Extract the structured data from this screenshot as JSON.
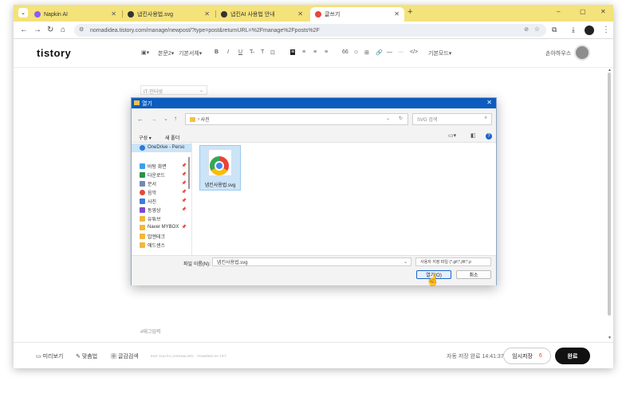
{
  "browser": {
    "tabs": [
      {
        "title": "Napkin AI",
        "color": "#8a5cf6"
      },
      {
        "title": "냅킨사용법.svg",
        "color": "#333333"
      },
      {
        "title": "냅킨AI 사용법 안내",
        "color": "#333333"
      },
      {
        "title": "글쓰기",
        "color": "#e8453c"
      }
    ],
    "new_tab": "+",
    "url": "nomadidea.tistory.com/manage/newpost/?type=post&returnURL=%2Fmanage%2Fposts%2F",
    "window_controls": [
      "–",
      "▢",
      "✕"
    ]
  },
  "editor": {
    "logo": "tistory",
    "toolbar": {
      "paragraph": "본문2",
      "font": "기본서체",
      "style": "기본모드"
    },
    "user": "손아하우스",
    "category_placeholder": "IT·인터넷",
    "tag_placeholder": "#태그입력"
  },
  "footer": {
    "preview": "미리보기",
    "spellcheck": "맞춤법",
    "search": "글감검색",
    "credits1": "EDIT SOUTH | CHROMLORG",
    "credits2": "POWERED BY TIFT",
    "autosave": "자동 저장 완료 14:41:37",
    "temp_save": "임시저장",
    "temp_count": "6",
    "done": "완료"
  },
  "dialog": {
    "title": "열기",
    "path_sep": "›",
    "path": "사진",
    "search_placeholder": "SVG 검색",
    "organize": "구성 ▾",
    "new_folder": "새 폴더",
    "sidebar": [
      {
        "label": "OneDrive - Perso",
        "color": "#2a7bd8",
        "pinned": false
      },
      {
        "label": "바탕 화면",
        "color": "#3aa0e8",
        "pinned": true
      },
      {
        "label": "다운로드",
        "color": "#2f8f4e",
        "pinned": true
      },
      {
        "label": "문서",
        "color": "#6f8bb0",
        "pinned": true
      },
      {
        "label": "음악",
        "color": "#e04a3c",
        "pinned": true
      },
      {
        "label": "사진",
        "color": "#3d7be0",
        "pinned": true
      },
      {
        "label": "동영상",
        "color": "#7a4bd0",
        "pinned": true
      },
      {
        "label": "유튜브",
        "color": "#f2b73b",
        "pinned": false
      },
      {
        "label": "Naver MYBOX",
        "color": "#f2b73b",
        "pinned": true
      },
      {
        "label": "밥앤테크",
        "color": "#f2b73b",
        "pinned": false
      },
      {
        "label": "애드센스",
        "color": "#f2b73b",
        "pinned": false
      }
    ],
    "file": {
      "name": "냅킨사용법.svg"
    },
    "filename_label": "파일 이름(N):",
    "filename_value": "냅킨사용법.svg",
    "filetype": "사용자 지정 파일 (*.gif;*.jfif;*.p",
    "open": "열기(O)",
    "cancel": "취소"
  }
}
